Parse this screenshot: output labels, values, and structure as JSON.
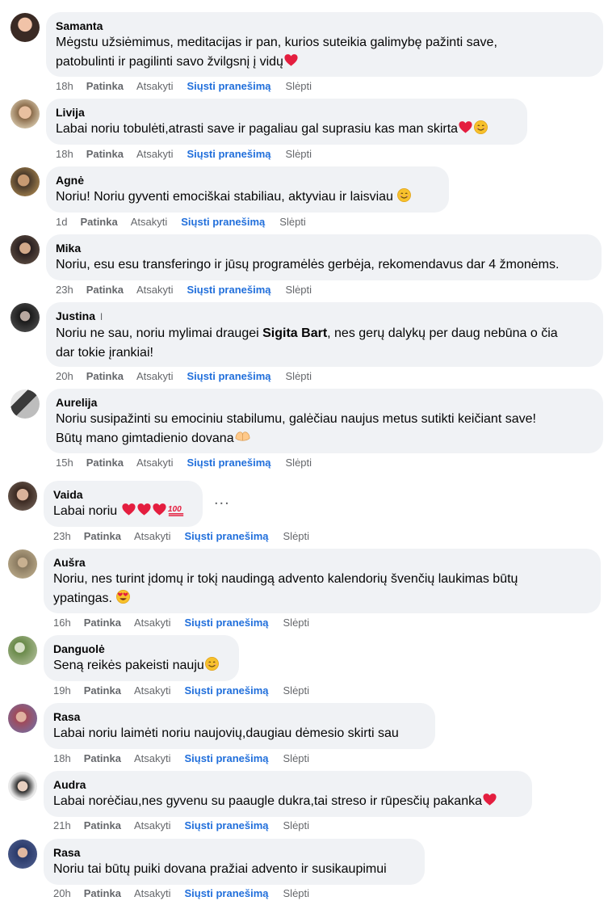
{
  "actions": {
    "like": "Patinka",
    "reply": "Atsakyti",
    "message": "Siųsti pranešimą",
    "hide": "Slėpti"
  },
  "more_label": "...",
  "colors": {
    "bubble": "#f0f2f5",
    "link": "#216fdb",
    "meta": "#65676b",
    "heart": "#e41e3f"
  },
  "comments": [
    {
      "author": "Samanta",
      "text_lines": [
        "Mėgstu užsiėmimus, meditacijas ir pan, kurios suteikia galimybę pažinti save,",
        "patobulinti ir pagilinti savo žvilgsnį į vidų"
      ],
      "emoji": "heart",
      "time": "18h"
    },
    {
      "author": "Livija",
      "text_lines": [
        "Labai noriu tobulėti,atrasti save ir pagaliau gal suprasiu kas man skirta"
      ],
      "emoji": "heart-smile",
      "time": "18h"
    },
    {
      "author": "Agnė",
      "text_lines": [
        "Noriu! Noriu gyventi emociškai stabiliau, aktyviau ir laisviau "
      ],
      "emoji": "smile",
      "time": "1d"
    },
    {
      "author": "Mika",
      "text_lines": [
        "Noriu, esu esu transferingo ir jūsų programėlės gerbėja, rekomendavus dar 4 žmonėms."
      ],
      "time": "23h"
    },
    {
      "author": "Justina",
      "author_mark": "I",
      "text_pre": "Noriu ne sau, noriu mylimai draugei ",
      "text_bold": "Sigita Bart",
      "text_post": ", nes gerų dalykų per daug nebūna o čia",
      "text_line2": "dar tokie įrankiai!",
      "time": "20h"
    },
    {
      "author": "Aurelija",
      "text_lines": [
        "Noriu susipažinti su emociniu stabilumu, galėčiau naujus metus sutikti keičiant save!",
        "Būtų mano gimtadienio dovana"
      ],
      "emoji": "heart-hands",
      "time": "15h"
    },
    {
      "author": "Vaida",
      "text_lines": [
        "Labai noriu "
      ],
      "emoji": "hearts-100",
      "time": "23h"
    },
    {
      "author": "Aušra",
      "text_lines": [
        "Noriu, nes turint įdomų ir tokį naudingą advento kalendorių švenčių laukimas būtų",
        "ypatingas. "
      ],
      "emoji": "heart-eyes",
      "time": "16h"
    },
    {
      "author": "Danguolė",
      "text_lines": [
        "Seną reikės pakeisti nauju"
      ],
      "emoji": "smile",
      "time": "19h"
    },
    {
      "author": "Rasa",
      "text_lines": [
        "Labai noriu laimėti noriu naujovių,daugiau dėmesio skirti sau"
      ],
      "time": "18h"
    },
    {
      "author": "Audra",
      "text_lines": [
        "Labai norėčiau,nes gyvenu su paaugle dukra,tai streso ir rūpesčių pakanka"
      ],
      "emoji": "heart",
      "time": "21h"
    },
    {
      "author": "Rasa",
      "text_lines": [
        "Noriu tai būtų puiki dovana pražiai advento ir susikaupimui"
      ],
      "time": "20h"
    }
  ]
}
